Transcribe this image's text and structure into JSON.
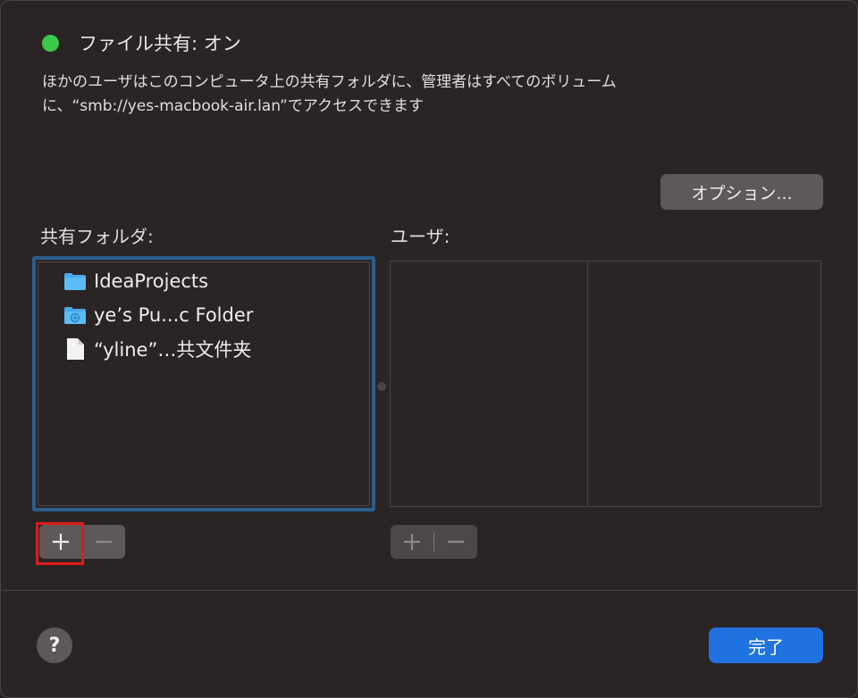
{
  "header": {
    "status_title": "ファイル共有: オン",
    "description": "ほかのユーザはこのコンピュータ上の共有フォルダに、管理者はすべてのボリューム\nに、“smb://yes-macbook-air.lan”でアクセスできます",
    "status_color": "#3cc84a"
  },
  "options_button": {
    "label": "オプション..."
  },
  "shared_folders": {
    "label": "共有フォルダ:",
    "items": [
      {
        "label": "IdeaProjects",
        "icon": "folder-icon"
      },
      {
        "label": "ye’s Pu...c Folder",
        "icon": "public-folder-icon"
      },
      {
        "label": "“yline”…共文件夹",
        "icon": "document-icon"
      }
    ],
    "add_label": "+",
    "remove_label": "−"
  },
  "users": {
    "label": "ユーザ:",
    "add_label": "+",
    "remove_label": "−"
  },
  "footer": {
    "help_label": "?",
    "done_label": "完了",
    "accent_color": "#1f72e0"
  },
  "annotation": {
    "highlight_color": "#e01b1b"
  }
}
